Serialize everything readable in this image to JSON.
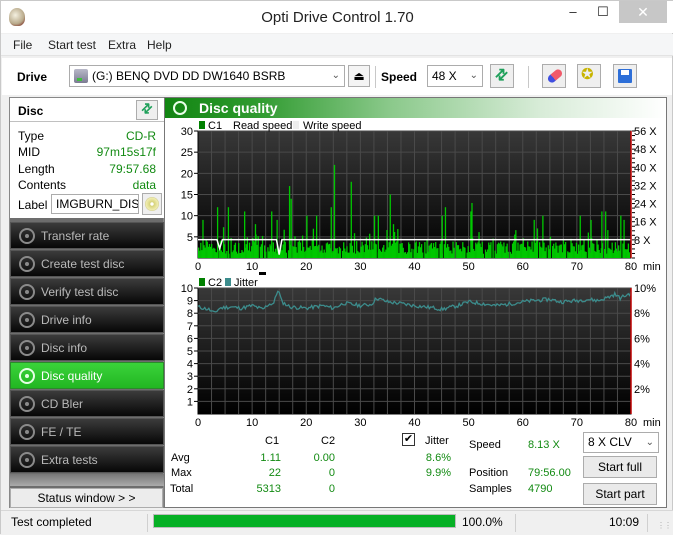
{
  "window": {
    "title": "Opti Drive Control 1.70",
    "controls": {
      "minimize": "‒",
      "maximize": "☐",
      "close": "✕"
    }
  },
  "menu": [
    "File",
    "Start test",
    "Extra",
    "Help"
  ],
  "toolbar": {
    "drive_label": "Drive",
    "drive_value": "(G:)  BENQ DVD DD DW1640 BSRB",
    "eject_icon": "eject-icon",
    "speed_label": "Speed",
    "speed_value": "48 X",
    "icons": [
      "refresh-icon",
      "erase-icon",
      "settings-gears-icon",
      "save-icon"
    ]
  },
  "disc": {
    "title": "Disc",
    "rows": [
      {
        "key": "Type",
        "value": "CD-R"
      },
      {
        "key": "MID",
        "value": "97m15s17f"
      },
      {
        "key": "Length",
        "value": "79:57.68"
      },
      {
        "key": "Contents",
        "value": "data"
      }
    ],
    "label_key": "Label",
    "label_value": "IMGBURN_DISC"
  },
  "nav": [
    {
      "label": "Transfer rate",
      "active": false
    },
    {
      "label": "Create test disc",
      "active": false
    },
    {
      "label": "Verify test disc",
      "active": false
    },
    {
      "label": "Drive info",
      "active": false
    },
    {
      "label": "Disc info",
      "active": false
    },
    {
      "label": "Disc quality",
      "active": true
    },
    {
      "label": "CD Bler",
      "active": false
    },
    {
      "label": "FE / TE",
      "active": false
    },
    {
      "label": "Extra tests",
      "active": false
    }
  ],
  "status_window_button": "Status window > >",
  "panel": {
    "title": "Disc quality"
  },
  "chart_data": [
    {
      "type": "bar",
      "title": "C1",
      "legend": [
        {
          "name": "C1",
          "color": "#008000"
        },
        {
          "name": "Read speed",
          "color": "#ffffff"
        },
        {
          "name": "Write speed",
          "color": "#eeeeee"
        }
      ],
      "legend_placement": "top-left",
      "xlabel": "min",
      "xlim": [
        0,
        80
      ],
      "xticks": [
        0,
        10,
        20,
        30,
        40,
        50,
        60,
        70,
        80
      ],
      "ylim": [
        0,
        30
      ],
      "yticks": [
        5,
        10,
        15,
        20,
        25,
        30
      ],
      "y2lim": [
        0,
        56
      ],
      "y2ticks": [
        "8 X",
        "16 X",
        "24 X",
        "32 X",
        "40 X",
        "48 X",
        "56 X"
      ],
      "grid": true,
      "series": [
        {
          "name": "C1",
          "color": "#00c800",
          "note": "per-sample error counts, approx. sampled every ~0.5 min",
          "peaks": [
            {
              "x": 0.8,
              "y": 9
            },
            {
              "x": 3.5,
              "y": 12
            },
            {
              "x": 5.5,
              "y": 12
            },
            {
              "x": 8.5,
              "y": 11
            },
            {
              "x": 10.5,
              "y": 8
            },
            {
              "x": 13.5,
              "y": 11
            },
            {
              "x": 14.5,
              "y": 9
            },
            {
              "x": 16.8,
              "y": 17
            },
            {
              "x": 17.1,
              "y": 14
            },
            {
              "x": 20,
              "y": 10
            },
            {
              "x": 21.8,
              "y": 10
            },
            {
              "x": 24.5,
              "y": 12
            },
            {
              "x": 25.1,
              "y": 22
            },
            {
              "x": 28.2,
              "y": 18
            },
            {
              "x": 32.5,
              "y": 10
            },
            {
              "x": 33.2,
              "y": 10
            },
            {
              "x": 35.4,
              "y": 15
            },
            {
              "x": 36,
              "y": 8
            },
            {
              "x": 45,
              "y": 10
            },
            {
              "x": 45.6,
              "y": 12
            },
            {
              "x": 50.3,
              "y": 11
            },
            {
              "x": 50.5,
              "y": 13
            },
            {
              "x": 62,
              "y": 9
            },
            {
              "x": 63.6,
              "y": 10
            },
            {
              "x": 70.5,
              "y": 10
            },
            {
              "x": 72.5,
              "y": 9
            },
            {
              "x": 74.5,
              "y": 11
            },
            {
              "x": 75.2,
              "y": 11
            },
            {
              "x": 78,
              "y": 10
            },
            {
              "x": 78.6,
              "y": 9
            }
          ],
          "baseline_typical": [
            1,
            4
          ]
        },
        {
          "name": "Read speed",
          "color": "#ffffff",
          "unit": "X",
          "value_approx": 8.1,
          "dips": [
            {
              "x": 4.0,
              "y": 4.2
            },
            {
              "x": 14.8,
              "y": 1.5
            }
          ]
        }
      ]
    },
    {
      "type": "line",
      "title": "C2 / Jitter",
      "legend": [
        {
          "name": "C2",
          "color": "#008000"
        },
        {
          "name": "Jitter",
          "color": "#3c8c8c"
        }
      ],
      "legend_placement": "top-left",
      "xlabel": "min",
      "xlim": [
        0,
        80
      ],
      "xticks": [
        0,
        10,
        20,
        30,
        40,
        50,
        60,
        70,
        80
      ],
      "ylim": [
        0,
        10
      ],
      "yticks": [
        1,
        2,
        3,
        4,
        5,
        6,
        7,
        8,
        9,
        10
      ],
      "y2lim": [
        0,
        10
      ],
      "y2ticks": [
        "2%",
        "4%",
        "6%",
        "8%",
        "10%"
      ],
      "grid": true,
      "series": [
        {
          "name": "C2",
          "color": "#008000",
          "values_all": 0
        },
        {
          "name": "Jitter",
          "color": "#3c8c8c",
          "unit": "%",
          "x": [
            0,
            2,
            3,
            4,
            6,
            8,
            10,
            12,
            13,
            14,
            14.8,
            15.5,
            17,
            20,
            23,
            25,
            27,
            30,
            32,
            33,
            35,
            37,
            40,
            42,
            44,
            45,
            48,
            50,
            52,
            55,
            57,
            60,
            62,
            65,
            67,
            70,
            72,
            74,
            76,
            77,
            78,
            79,
            80
          ],
          "y": [
            8.5,
            8.3,
            8.0,
            8.4,
            8.5,
            8.4,
            8.6,
            8.3,
            8.7,
            8.8,
            9.9,
            8.9,
            8.5,
            8.4,
            8.6,
            8.4,
            8.8,
            8.6,
            8.7,
            9.2,
            8.9,
            8.8,
            8.6,
            8.5,
            8.4,
            8.3,
            8.6,
            8.9,
            8.8,
            8.6,
            8.7,
            8.9,
            9.0,
            9.1,
            8.9,
            9.0,
            9.1,
            9.0,
            9.3,
            9.5,
            9.2,
            9.4,
            9.6
          ]
        }
      ]
    }
  ],
  "stats": {
    "col_c1": "C1",
    "col_c2": "C2",
    "jitter_checked": true,
    "jitter_label": "Jitter",
    "rows": [
      {
        "label": "Avg",
        "c1": "1.11",
        "c2": "0.00",
        "jitter": "8.6%"
      },
      {
        "label": "Max",
        "c1": "22",
        "c2": "0",
        "jitter": "9.9%"
      },
      {
        "label": "Total",
        "c1": "5313",
        "c2": "0",
        "jitter": ""
      }
    ],
    "speed_label": "Speed",
    "speed_value": "8.13 X",
    "position_label": "Position",
    "position_value": "79:56.00",
    "samples_label": "Samples",
    "samples_value": "4790",
    "test_speed_value": "8 X CLV",
    "start_full": "Start full",
    "start_part": "Start part"
  },
  "statusbar": {
    "text": "Test completed",
    "progress": 100.0,
    "progress_text": "100.0%",
    "time": "10:09"
  }
}
